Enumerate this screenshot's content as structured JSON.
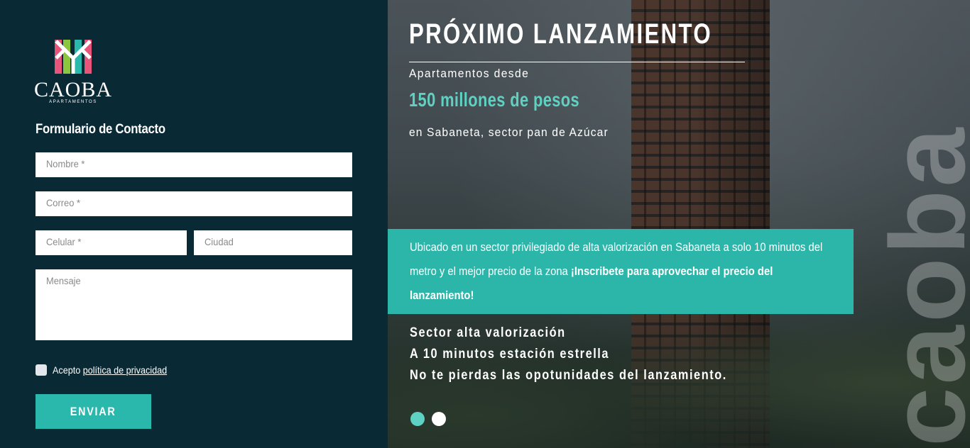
{
  "brand": {
    "name": "CAOBA",
    "tagline": "APARTAMENTOS",
    "colors": {
      "teal": "#2bb8ac",
      "dark": "#092935",
      "pink": "#e8557a",
      "green": "#8cc63f"
    }
  },
  "form": {
    "title": "Formulario de Contacto",
    "fields": {
      "nombre": "Nombre *",
      "correo": "Correo *",
      "celular": "Celular *",
      "ciudad": "Ciudad",
      "mensaje": "Mensaje"
    },
    "privacy_prefix": "Acepto",
    "privacy_link": "política de privacidad",
    "submit_label": "ENVIAR"
  },
  "hero": {
    "title": "PRÓXIMO LANZAMIENTO",
    "subtitle": "Apartamentos desde",
    "price": "150 millones de pesos",
    "location": "en Sabaneta, sector pan de Azúcar",
    "band_text": "Ubicado en un sector privilegiado de alta valorización en Sabaneta a solo 10 minutos del metro y el mejor precio de la zona",
    "band_cta": "¡Inscribete para aprovechar el precio del lanzamiento!",
    "features": [
      "Sector alta valorización",
      "A 10 minutos estación estrella",
      "No te pierdas las opotunidades del lanzamiento."
    ],
    "watermark": "caoba",
    "slider": {
      "total": 2,
      "active": 1
    }
  }
}
